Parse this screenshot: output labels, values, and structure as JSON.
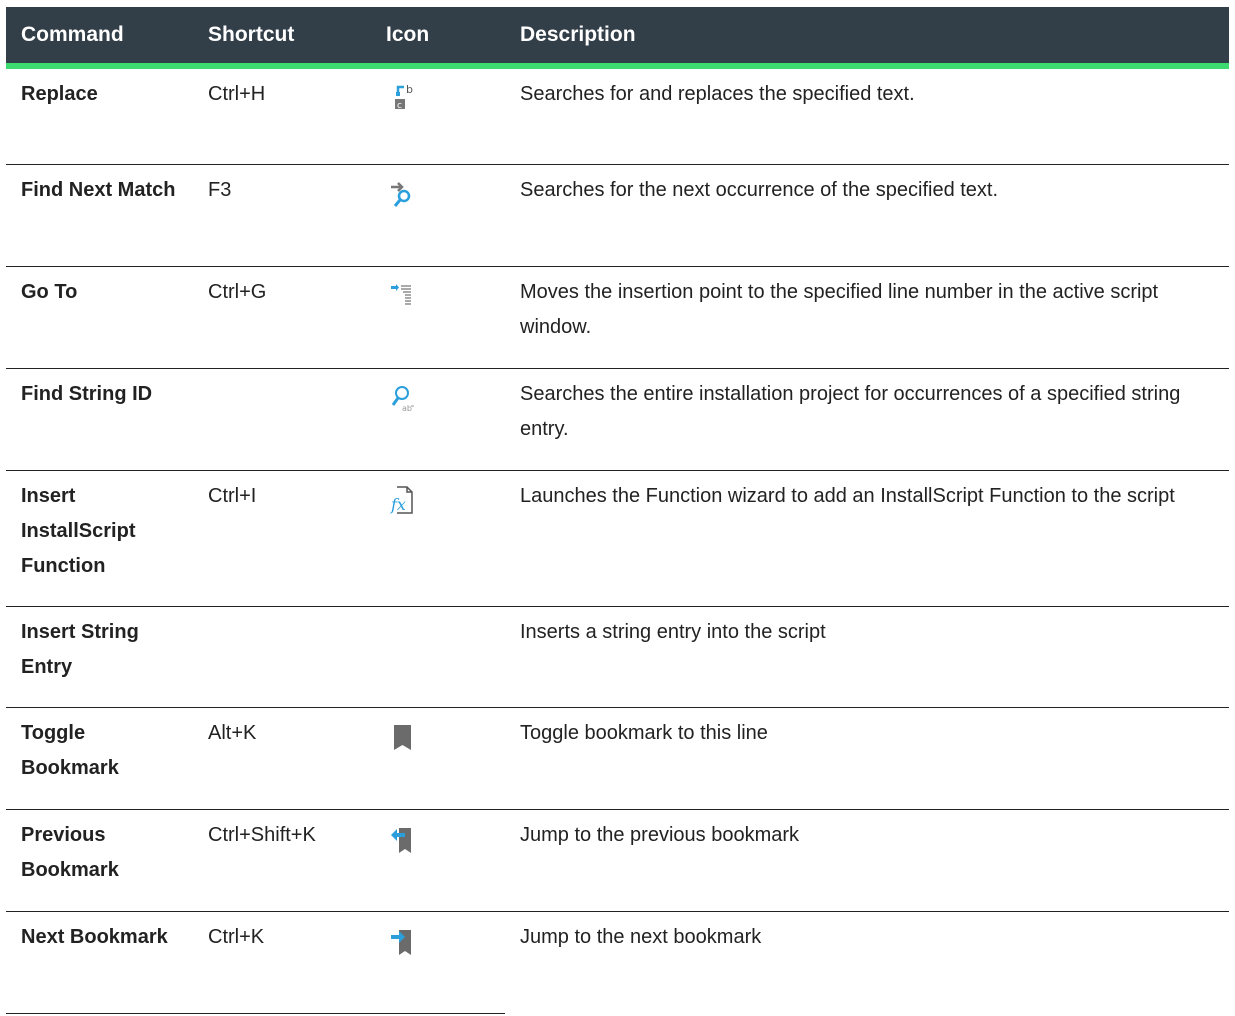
{
  "header": {
    "command": "Command",
    "shortcut": "Shortcut",
    "icon": "Icon",
    "description": "Description"
  },
  "colors": {
    "header_bg": "#333f48",
    "accent": "#3ddb6f",
    "icon_blue": "#2a9fdc",
    "icon_gray": "#6b6b6b"
  },
  "rows": [
    {
      "command": "Replace",
      "shortcut": "Ctrl+H",
      "icon": "replace-icon",
      "description": "Searches for and replaces the specified text."
    },
    {
      "command": "Find Next Match",
      "shortcut": "F3",
      "icon": "find-next-icon",
      "description": "Searches for the next occurrence of the specified text."
    },
    {
      "command": "Go To",
      "shortcut": "Ctrl+G",
      "icon": "go-to-icon",
      "description": "Moves the insertion point to the specified line number in the active script window."
    },
    {
      "command": "Find String ID",
      "shortcut": "",
      "icon": "find-string-icon",
      "description": "Searches the entire installation project for occurrences of a specified string entry."
    },
    {
      "command": "Insert InstallScript Function",
      "shortcut": "Ctrl+I",
      "icon": "function-icon",
      "description": "Launches the Function wizard to add an InstallScript Function to the script"
    },
    {
      "command": "Insert String Entry",
      "shortcut": "",
      "icon": "",
      "description": "Inserts a string entry into the script"
    },
    {
      "command": "Toggle Bookmark",
      "shortcut": "Alt+K",
      "icon": "bookmark-icon",
      "description": "Toggle bookmark to this line"
    },
    {
      "command": "Previous Bookmark",
      "shortcut": "Ctrl+Shift+K",
      "icon": "previous-bookmark-icon",
      "description": "Jump to the previous bookmark"
    },
    {
      "command": "Next Bookmark",
      "shortcut": "Ctrl+K",
      "icon": "next-bookmark-icon",
      "description": "Jump to the next bookmark"
    }
  ]
}
